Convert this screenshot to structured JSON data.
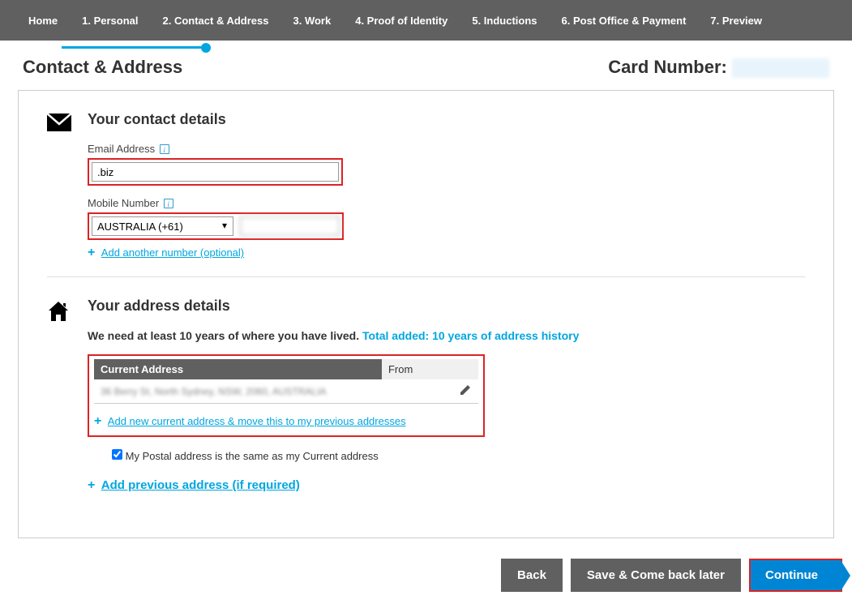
{
  "nav": {
    "home": "Home",
    "items": [
      "1. Personal",
      "2. Contact & Address",
      "3. Work",
      "4. Proof of Identity",
      "5. Inductions",
      "6. Post Office & Payment",
      "7. Preview"
    ]
  },
  "header": {
    "title": "Contact & Address",
    "card_label": "Card Number:",
    "card_value": " "
  },
  "contact": {
    "title": "Your contact details",
    "email_label": "Email Address",
    "email_value": ".biz",
    "mobile_label": "Mobile Number",
    "country_value": "AUSTRALIA (+61)",
    "phone_value": " ",
    "add_number": "Add another number (optional)"
  },
  "address": {
    "title": "Your address details",
    "msg": "We need at least 10 years of where you have lived.",
    "total": "Total added: 10 years of address history",
    "th_current": "Current Address",
    "th_from": "From",
    "row_addr": "36 Berry St, North Sydney, NSW, 2060, AUSTRALIA",
    "row_from": " ",
    "add_new_current": "Add new current address & move this to my previous addresses",
    "postal_same": "My Postal address is the same as my Current address",
    "add_previous": "Add previous address (if required)"
  },
  "footer": {
    "back": "Back",
    "save": "Save & Come back later",
    "continue": "Continue"
  }
}
